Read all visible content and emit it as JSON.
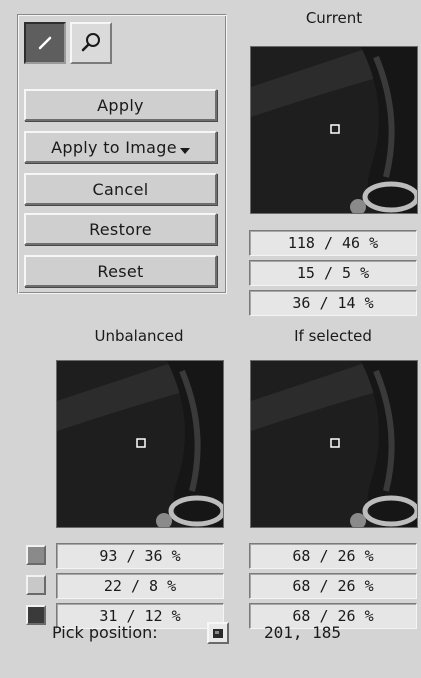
{
  "tools": {
    "pencil_icon": "pencil-icon",
    "magnifier_icon": "magnifier-icon"
  },
  "actions": {
    "apply": "Apply",
    "apply_to_image": "Apply to Image",
    "cancel": "Cancel",
    "restore": "Restore",
    "reset": "Reset"
  },
  "current": {
    "title": "Current",
    "values": [
      "118 / 46 %",
      "15 / 5 %",
      "36 / 14 %"
    ]
  },
  "unbalanced": {
    "title": "Unbalanced",
    "values": [
      "93 / 36 %",
      "22 / 8 %",
      "31 / 12 %"
    ]
  },
  "if_selected": {
    "title": "If selected",
    "values": [
      "68 / 26 %",
      "68 / 26 %",
      "68 / 26 %"
    ]
  },
  "swatches": [
    "#8a8a8a",
    "#c8c8c8",
    "#3a3a3a"
  ],
  "pick": {
    "label": "Pick position:",
    "value": "201, 185"
  }
}
